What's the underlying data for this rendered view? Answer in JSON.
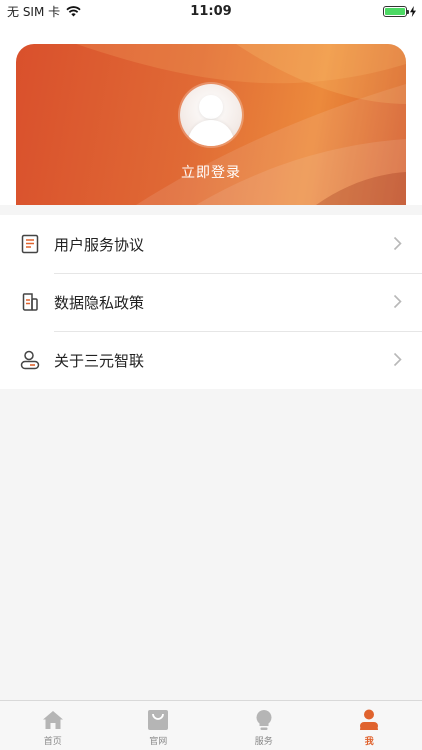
{
  "status_bar": {
    "carrier": "无 SIM 卡",
    "time": "11:09"
  },
  "profile": {
    "login_text": "立即登录"
  },
  "menu": {
    "items": [
      {
        "label": "用户服务协议",
        "icon": "document-list-icon"
      },
      {
        "label": "数据隐私政策",
        "icon": "privacy-document-icon"
      },
      {
        "label": "关于三元智联",
        "icon": "user-info-icon"
      }
    ]
  },
  "tab_bar": {
    "items": [
      {
        "label": "首页",
        "icon": "home-icon"
      },
      {
        "label": "官网",
        "icon": "shopping-bag-icon"
      },
      {
        "label": "服务",
        "icon": "lightbulb-icon"
      },
      {
        "label": "我",
        "icon": "person-icon",
        "active": true
      }
    ]
  },
  "colors": {
    "accent": "#e0632e",
    "card_gradient_start": "#d9502c",
    "card_gradient_end": "#ec8a3c",
    "inactive_icon": "#b5b5b5"
  }
}
